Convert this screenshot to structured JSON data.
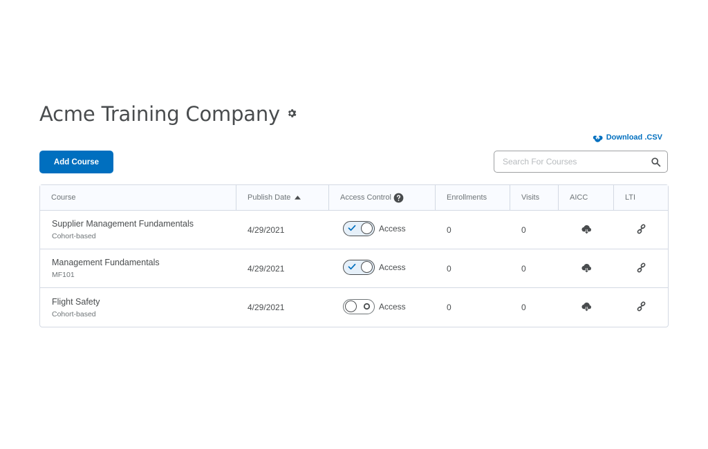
{
  "header": {
    "title": "Acme Training Company",
    "settings_icon": "gear-icon"
  },
  "toolbar": {
    "add_course_label": "Add Course",
    "download_label": "Download .CSV",
    "download_icon": "cloud-download-icon",
    "search_placeholder": "Search For Courses",
    "search_value": "",
    "search_icon": "search-icon"
  },
  "table": {
    "columns": {
      "course": "Course",
      "publish_date": "Publish Date",
      "access_control": "Access Control",
      "enrollments": "Enrollments",
      "visits": "Visits",
      "aicc": "AICC",
      "lti": "LTI"
    },
    "sort_indicator": "sort-ascending-icon",
    "help_icon": "help-circle-icon",
    "rows": [
      {
        "name": "Supplier Management Fundamentals",
        "subtitle": "Cohort-based",
        "publish_date": "4/29/2021",
        "access_on": true,
        "access_label": "Access",
        "enrollments": "0",
        "visits": "0"
      },
      {
        "name": "Management Fundamentals",
        "subtitle": "MF101",
        "publish_date": "4/29/2021",
        "access_on": true,
        "access_label": "Access",
        "enrollments": "0",
        "visits": "0"
      },
      {
        "name": "Flight Safety",
        "subtitle": "Cohort-based",
        "publish_date": "4/29/2021",
        "access_on": false,
        "access_label": "Access",
        "enrollments": "0",
        "visits": "0"
      }
    ]
  },
  "colors": {
    "primary": "#006fbf",
    "text": "#494c4e",
    "border": "#d3d9e3",
    "header_bg": "#f9fbff"
  }
}
